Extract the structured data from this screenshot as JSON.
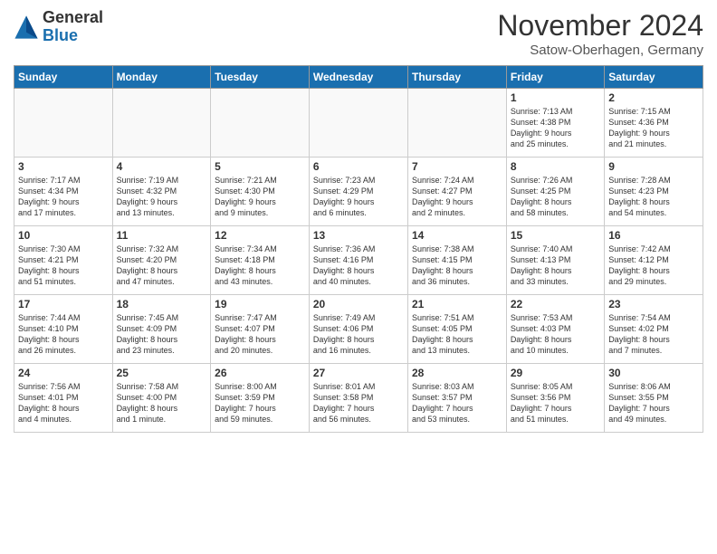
{
  "header": {
    "logo_line1": "General",
    "logo_line2": "Blue",
    "month": "November 2024",
    "location": "Satow-Oberhagen, Germany"
  },
  "weekdays": [
    "Sunday",
    "Monday",
    "Tuesday",
    "Wednesday",
    "Thursday",
    "Friday",
    "Saturday"
  ],
  "weeks": [
    [
      {
        "day": "",
        "info": ""
      },
      {
        "day": "",
        "info": ""
      },
      {
        "day": "",
        "info": ""
      },
      {
        "day": "",
        "info": ""
      },
      {
        "day": "",
        "info": ""
      },
      {
        "day": "1",
        "info": "Sunrise: 7:13 AM\nSunset: 4:38 PM\nDaylight: 9 hours\nand 25 minutes."
      },
      {
        "day": "2",
        "info": "Sunrise: 7:15 AM\nSunset: 4:36 PM\nDaylight: 9 hours\nand 21 minutes."
      }
    ],
    [
      {
        "day": "3",
        "info": "Sunrise: 7:17 AM\nSunset: 4:34 PM\nDaylight: 9 hours\nand 17 minutes."
      },
      {
        "day": "4",
        "info": "Sunrise: 7:19 AM\nSunset: 4:32 PM\nDaylight: 9 hours\nand 13 minutes."
      },
      {
        "day": "5",
        "info": "Sunrise: 7:21 AM\nSunset: 4:30 PM\nDaylight: 9 hours\nand 9 minutes."
      },
      {
        "day": "6",
        "info": "Sunrise: 7:23 AM\nSunset: 4:29 PM\nDaylight: 9 hours\nand 6 minutes."
      },
      {
        "day": "7",
        "info": "Sunrise: 7:24 AM\nSunset: 4:27 PM\nDaylight: 9 hours\nand 2 minutes."
      },
      {
        "day": "8",
        "info": "Sunrise: 7:26 AM\nSunset: 4:25 PM\nDaylight: 8 hours\nand 58 minutes."
      },
      {
        "day": "9",
        "info": "Sunrise: 7:28 AM\nSunset: 4:23 PM\nDaylight: 8 hours\nand 54 minutes."
      }
    ],
    [
      {
        "day": "10",
        "info": "Sunrise: 7:30 AM\nSunset: 4:21 PM\nDaylight: 8 hours\nand 51 minutes."
      },
      {
        "day": "11",
        "info": "Sunrise: 7:32 AM\nSunset: 4:20 PM\nDaylight: 8 hours\nand 47 minutes."
      },
      {
        "day": "12",
        "info": "Sunrise: 7:34 AM\nSunset: 4:18 PM\nDaylight: 8 hours\nand 43 minutes."
      },
      {
        "day": "13",
        "info": "Sunrise: 7:36 AM\nSunset: 4:16 PM\nDaylight: 8 hours\nand 40 minutes."
      },
      {
        "day": "14",
        "info": "Sunrise: 7:38 AM\nSunset: 4:15 PM\nDaylight: 8 hours\nand 36 minutes."
      },
      {
        "day": "15",
        "info": "Sunrise: 7:40 AM\nSunset: 4:13 PM\nDaylight: 8 hours\nand 33 minutes."
      },
      {
        "day": "16",
        "info": "Sunrise: 7:42 AM\nSunset: 4:12 PM\nDaylight: 8 hours\nand 29 minutes."
      }
    ],
    [
      {
        "day": "17",
        "info": "Sunrise: 7:44 AM\nSunset: 4:10 PM\nDaylight: 8 hours\nand 26 minutes."
      },
      {
        "day": "18",
        "info": "Sunrise: 7:45 AM\nSunset: 4:09 PM\nDaylight: 8 hours\nand 23 minutes."
      },
      {
        "day": "19",
        "info": "Sunrise: 7:47 AM\nSunset: 4:07 PM\nDaylight: 8 hours\nand 20 minutes."
      },
      {
        "day": "20",
        "info": "Sunrise: 7:49 AM\nSunset: 4:06 PM\nDaylight: 8 hours\nand 16 minutes."
      },
      {
        "day": "21",
        "info": "Sunrise: 7:51 AM\nSunset: 4:05 PM\nDaylight: 8 hours\nand 13 minutes."
      },
      {
        "day": "22",
        "info": "Sunrise: 7:53 AM\nSunset: 4:03 PM\nDaylight: 8 hours\nand 10 minutes."
      },
      {
        "day": "23",
        "info": "Sunrise: 7:54 AM\nSunset: 4:02 PM\nDaylight: 8 hours\nand 7 minutes."
      }
    ],
    [
      {
        "day": "24",
        "info": "Sunrise: 7:56 AM\nSunset: 4:01 PM\nDaylight: 8 hours\nand 4 minutes."
      },
      {
        "day": "25",
        "info": "Sunrise: 7:58 AM\nSunset: 4:00 PM\nDaylight: 8 hours\nand 1 minute."
      },
      {
        "day": "26",
        "info": "Sunrise: 8:00 AM\nSunset: 3:59 PM\nDaylight: 7 hours\nand 59 minutes."
      },
      {
        "day": "27",
        "info": "Sunrise: 8:01 AM\nSunset: 3:58 PM\nDaylight: 7 hours\nand 56 minutes."
      },
      {
        "day": "28",
        "info": "Sunrise: 8:03 AM\nSunset: 3:57 PM\nDaylight: 7 hours\nand 53 minutes."
      },
      {
        "day": "29",
        "info": "Sunrise: 8:05 AM\nSunset: 3:56 PM\nDaylight: 7 hours\nand 51 minutes."
      },
      {
        "day": "30",
        "info": "Sunrise: 8:06 AM\nSunset: 3:55 PM\nDaylight: 7 hours\nand 49 minutes."
      }
    ]
  ]
}
